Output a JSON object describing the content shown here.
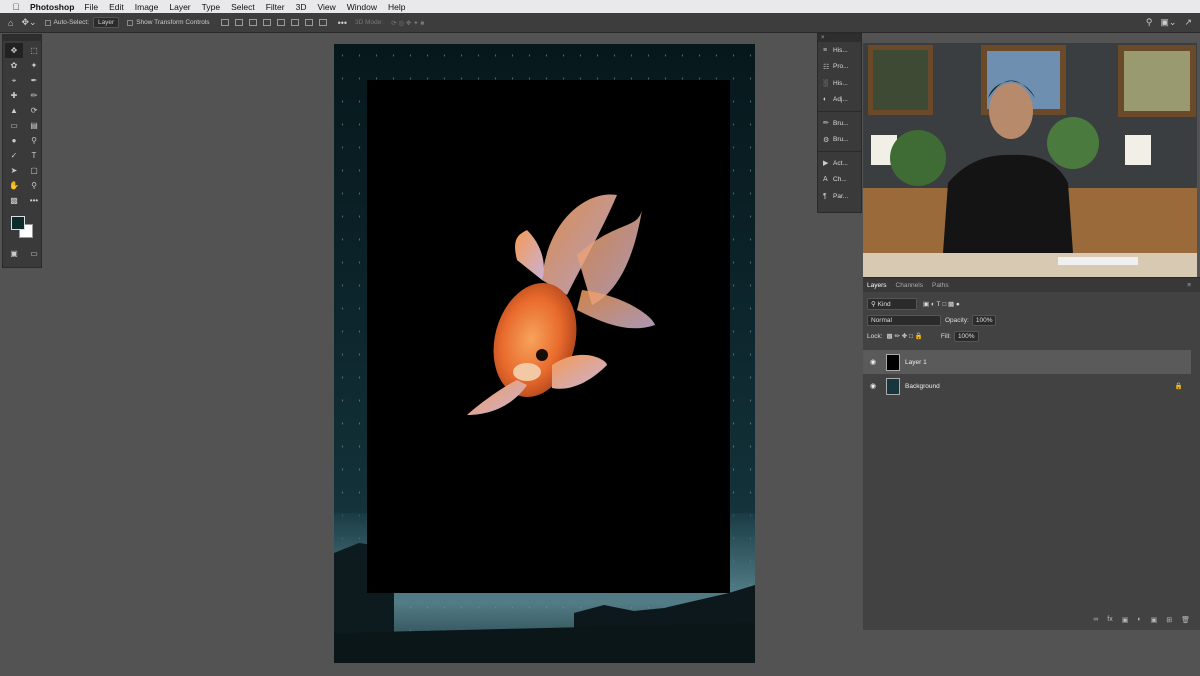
{
  "menubar": {
    "apple": "",
    "app_name": "Photoshop",
    "items": [
      "File",
      "Edit",
      "Image",
      "Layer",
      "Type",
      "Select",
      "Filter",
      "3D",
      "View",
      "Window",
      "Help"
    ]
  },
  "options_bar": {
    "auto_select_label": "Auto-Select:",
    "auto_select_value": "Layer",
    "transform_label": "Show Transform Controls",
    "mode_3d_label": "3D Mode:"
  },
  "panels": {
    "items": [
      {
        "label": "His...",
        "icon": "history-icon"
      },
      {
        "label": "Pro...",
        "icon": "properties-icon"
      },
      {
        "label": "His...",
        "icon": "histogram-icon"
      },
      {
        "label": "Adj...",
        "icon": "adjustments-icon"
      },
      {
        "label": "Bru...",
        "icon": "brush-icon"
      },
      {
        "label": "Bru...",
        "icon": "brush-settings-icon"
      },
      {
        "label": "Act...",
        "icon": "actions-icon"
      },
      {
        "label": "Ch...",
        "icon": "character-icon"
      },
      {
        "label": "Par...",
        "icon": "paragraph-icon"
      }
    ]
  },
  "layers_panel": {
    "tabs": [
      "Layers",
      "Channels",
      "Paths"
    ],
    "kind_label": "Kind",
    "blend_mode": "Normal",
    "opacity_label": "Opacity:",
    "opacity_value": "100%",
    "lock_label": "Lock:",
    "fill_label": "Fill:",
    "fill_value": "100%",
    "layers": [
      {
        "name": "Layer 1",
        "selected": true
      },
      {
        "name": "Background",
        "selected": false
      }
    ]
  },
  "colors": {
    "foreground": "#0d2a2c",
    "background": "#ffffff",
    "ui_dark": "#3a3a3a"
  }
}
